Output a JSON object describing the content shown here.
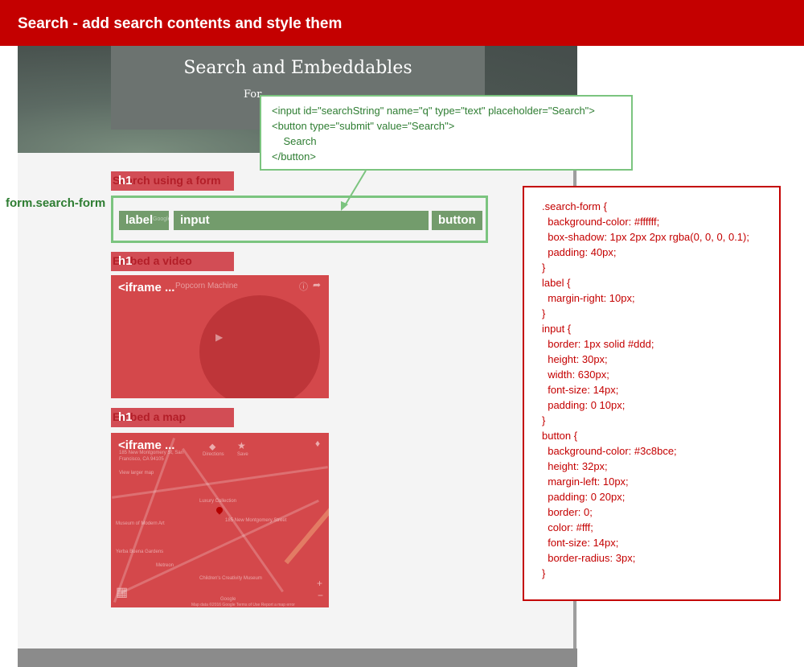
{
  "header": {
    "title": "Search - add search contents and style them"
  },
  "hero": {
    "title": "Search and Embeddables",
    "subtitle": "For"
  },
  "sections": [
    {
      "tag": "h1",
      "heading": "Search using a form"
    },
    {
      "tag": "h1",
      "heading": "Embed a video"
    },
    {
      "tag": "h1",
      "heading": "Embed a map"
    }
  ],
  "form": {
    "selector": "form.search-form",
    "label_box": "label",
    "input_box": "input",
    "button_box": "button",
    "ghost_label": "Google"
  },
  "video": {
    "iframe_label": "<iframe ...",
    "ghost_title": "Popcorn Machine"
  },
  "map": {
    "iframe_label": "<iframe ...",
    "address_line1": "185 New Montgomery St, San",
    "address_line2": "Francisco, CA 94105",
    "view_larger": "View larger map",
    "directions": "Directions",
    "save": "Save",
    "pin_label": "185 New Montgomery Street",
    "area1": "Museum of Modern Art",
    "area2": "Yerba Buena Gardens",
    "area3": "Metreon",
    "area4": "Children's Creativity Museum",
    "area5": "Luxury Collection",
    "google": "Google",
    "footer": "Map data ©2016 Google   Terms of Use   Report a map error"
  },
  "callout": {
    "lines": [
      "<input id=\"searchString\" name=\"q\" type=\"text\" placeholder=\"Search\">",
      "<button type=\"submit\" value=\"Search\">",
      "    Search",
      "</button>"
    ]
  },
  "css_code": {
    "lines": [
      ".search-form {",
      "  background-color: #ffffff;",
      "  box-shadow: 1px 2px 2px rgba(0, 0, 0, 0.1);",
      "  padding: 40px;",
      "}",
      "label {",
      "  margin-right: 10px;",
      "}",
      "input {",
      "  border: 1px solid #ddd;",
      "  height: 30px;",
      "  width: 630px;",
      "  font-size: 14px;",
      "  padding: 0 10px;",
      "}",
      "button {",
      "  background-color: #3c8bce;",
      "  height: 32px;",
      "  margin-left: 10px;",
      "  padding: 0 20px;",
      "  border: 0;",
      "  color: #fff;",
      "  font-size: 14px;",
      "  border-radius: 3px;",
      "}"
    ]
  },
  "colors": {
    "header": "#c40000",
    "callout_border": "#7bc47f",
    "css_border": "#c40000",
    "overlay_red": "#d4484b",
    "overlay_green": "#739c6c"
  }
}
